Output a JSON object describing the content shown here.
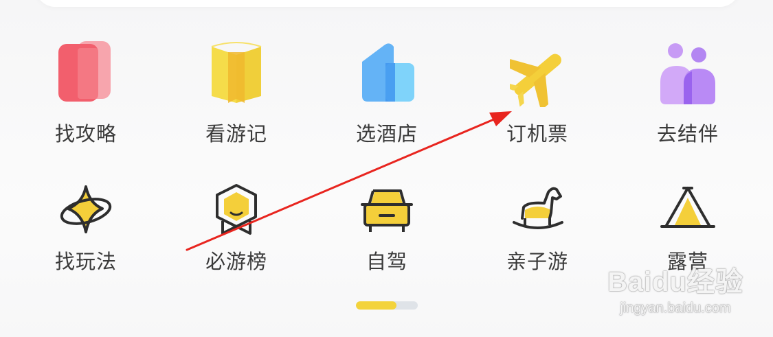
{
  "menu_rows": [
    [
      {
        "label": "找攻略",
        "icon": "guide-book-icon"
      },
      {
        "label": "看游记",
        "icon": "open-book-icon"
      },
      {
        "label": "选酒店",
        "icon": "hotel-building-icon"
      },
      {
        "label": "订机票",
        "icon": "airplane-icon"
      },
      {
        "label": "去结伴",
        "icon": "companions-icon"
      }
    ],
    [
      {
        "label": "找玩法",
        "icon": "sparkle-planet-icon"
      },
      {
        "label": "必游榜",
        "icon": "ranking-badge-icon"
      },
      {
        "label": "自驾",
        "icon": "car-icon"
      },
      {
        "label": "亲子游",
        "icon": "rocking-horse-icon"
      },
      {
        "label": "露营",
        "icon": "tent-icon"
      }
    ]
  ],
  "page_indicator": {
    "current_page": 1,
    "total_pages": 2,
    "progress": 0.66
  },
  "annotation": {
    "type": "arrow",
    "color": "#e8251f",
    "points_to": "订机票"
  },
  "watermark": {
    "brand": "Baidu经验",
    "url": "jingyan.baidu.com"
  },
  "colors": {
    "label_text": "#3a3a3a",
    "accent_yellow": "#f3d33c",
    "indicator_track": "#dfe3e8",
    "red_icon": "#f0606c",
    "blue_icon": "#5aaef5",
    "purple_icon": "#b07af2"
  }
}
